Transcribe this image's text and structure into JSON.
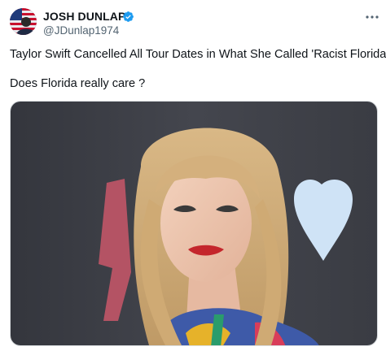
{
  "author": {
    "display_name": "JOSH DUNLAP",
    "handle": "@JDunlap1974",
    "verified": true,
    "avatar_icon": "flag-avatar"
  },
  "menu_icon": "more-icon",
  "tweet": {
    "line1": "Taylor Swift Cancelled All Tour Dates in What She Called 'Racist Florida'.",
    "line2": "Does Florida really care ?"
  },
  "media": {
    "description_icon": "photo",
    "backdrop_color": "#3d3f47"
  },
  "colors": {
    "verified_blue": "#1d9bf0",
    "text": "#0f1419",
    "muted": "#536471"
  }
}
